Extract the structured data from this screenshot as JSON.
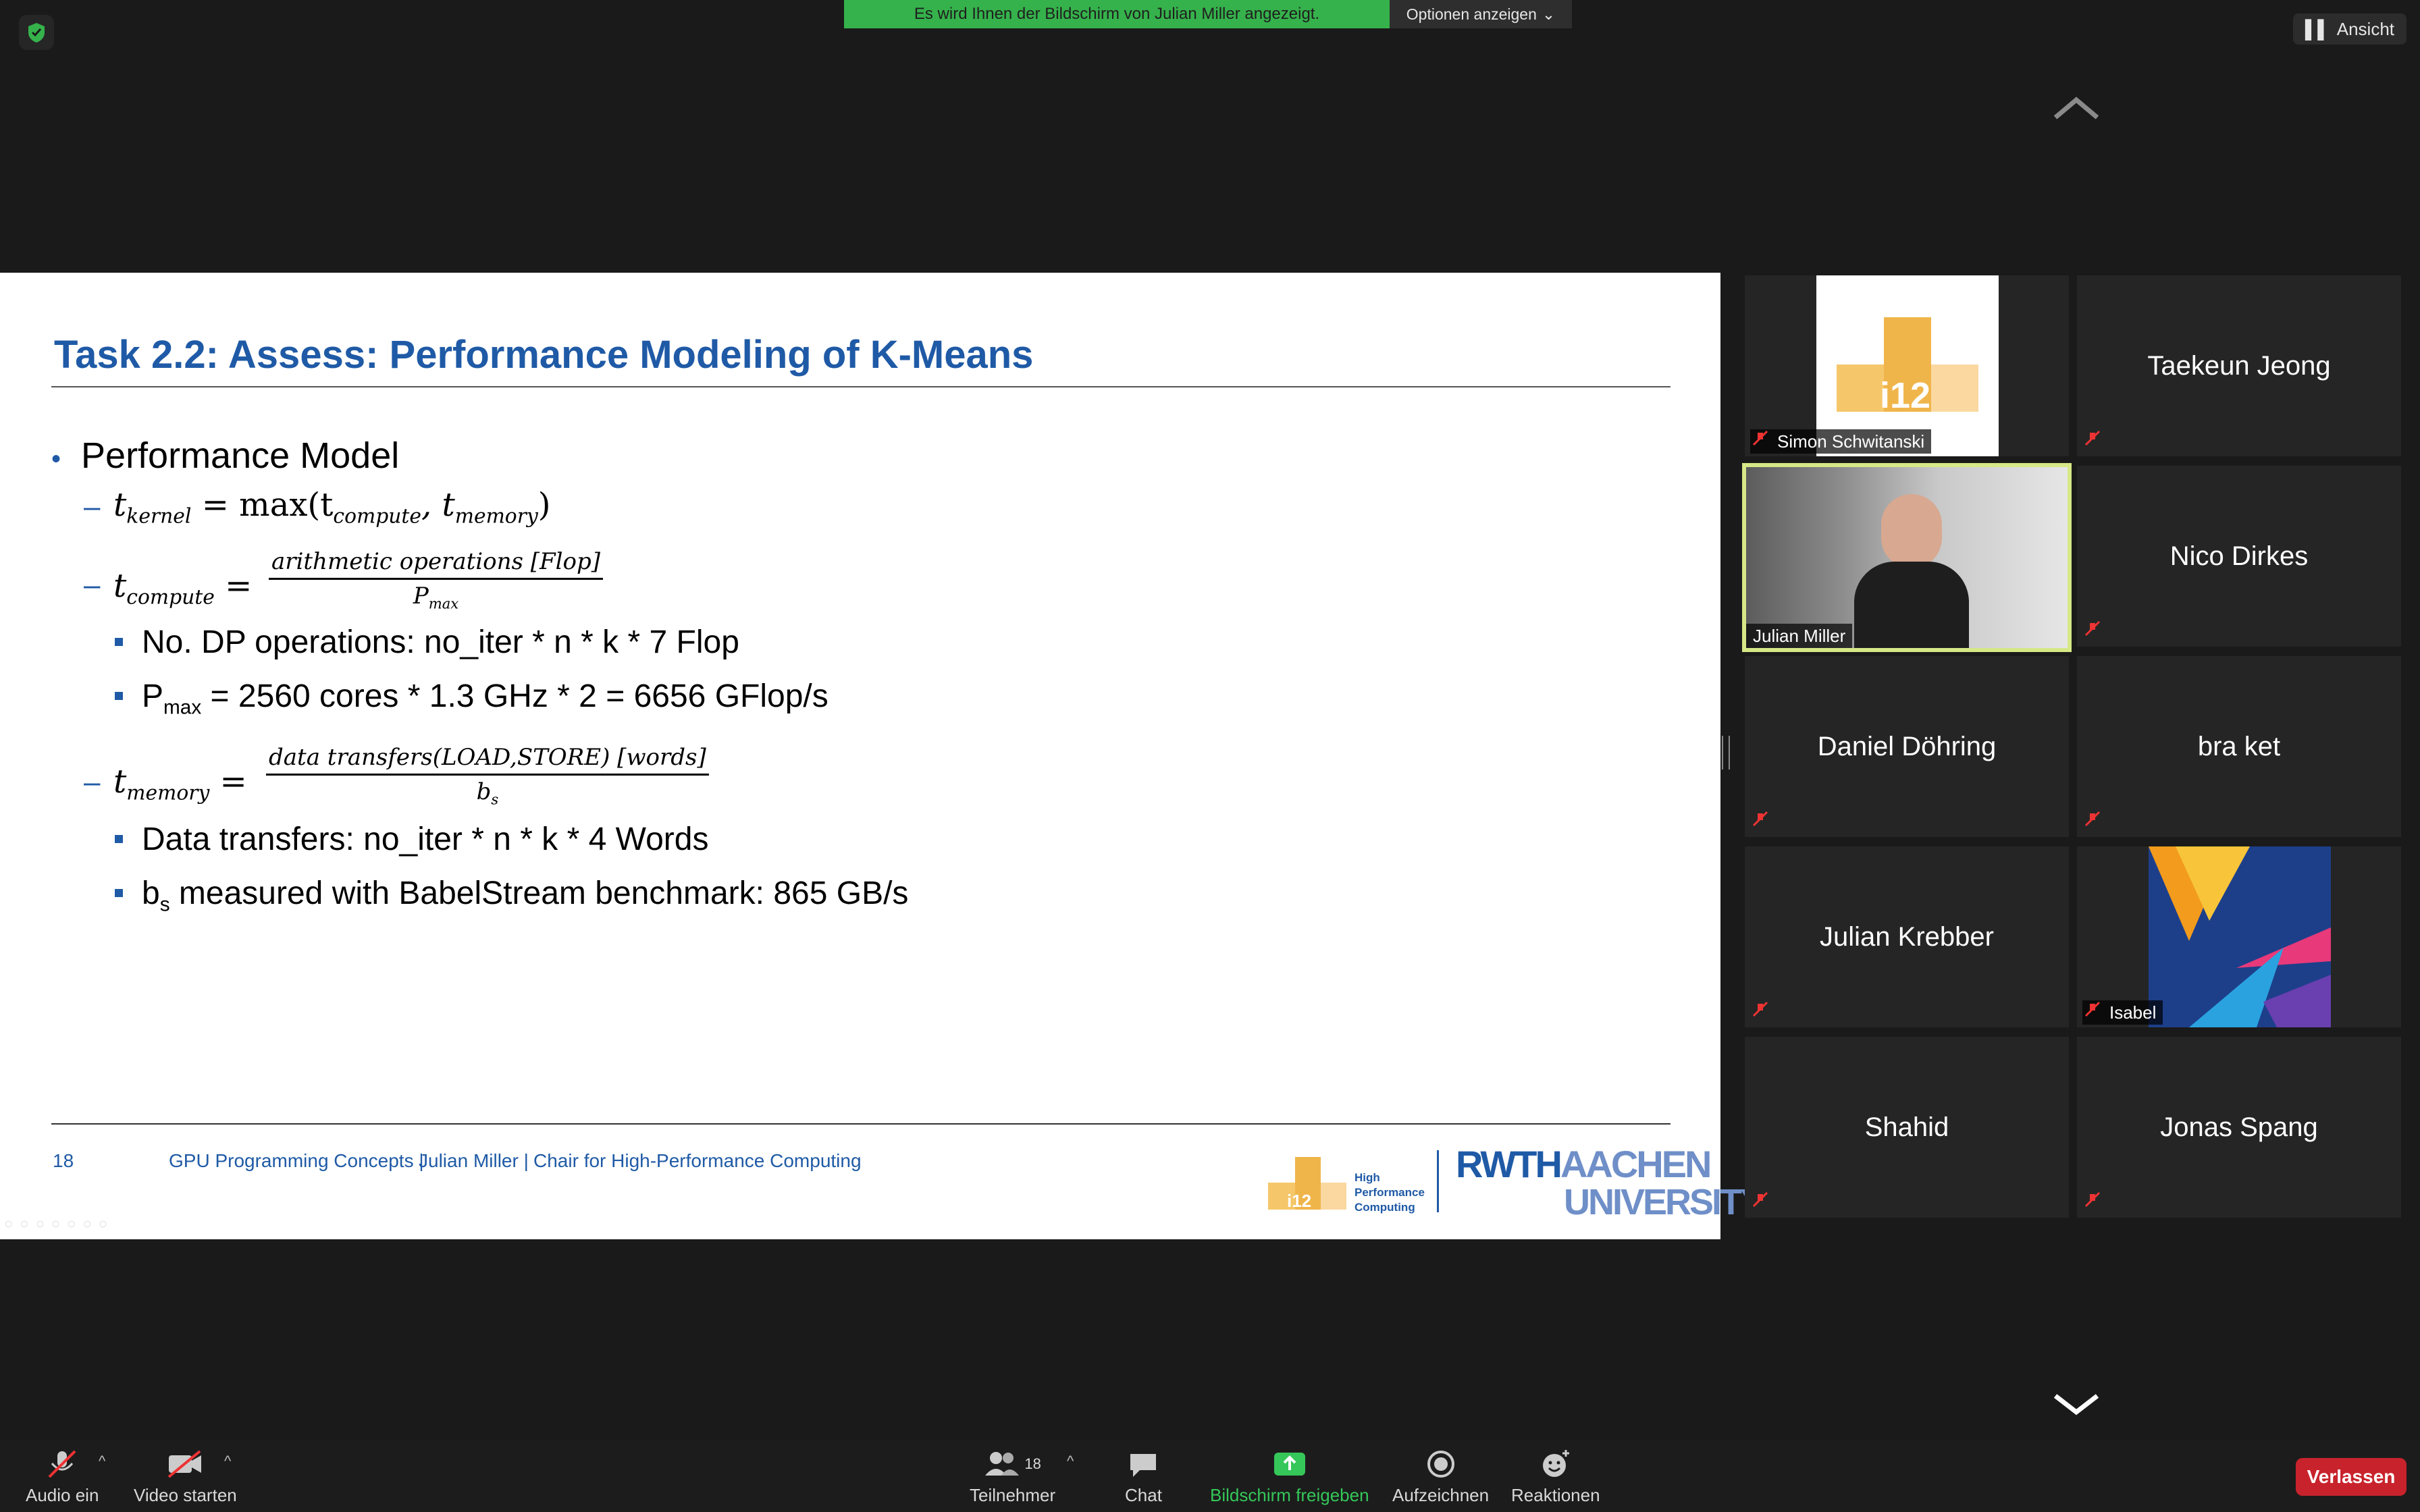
{
  "topbar": {
    "banner_text": "Es wird Ihnen der Bildschirm von Julian Miller angezeigt.",
    "options_label": "Optionen anzeigen",
    "view_label": "Ansicht",
    "security_icon": "shield-check-icon"
  },
  "slide": {
    "title": "Task 2.2: Assess: Performance Modeling of K-Means",
    "bullet_main": "Performance Model",
    "eq_kernel": {
      "lhs": "t",
      "lhs_sub": "kernel",
      "rhs": "= max(t",
      "sub1": "compute",
      "mid": ", t",
      "sub2": "memory",
      "end": ")"
    },
    "eq_compute": {
      "lhs": "t",
      "lhs_sub": "compute",
      "num": "arithmetic operations [Flop]",
      "den": "P",
      "den_sub": "max"
    },
    "compute_items": {
      "dp_ops": "No. DP operations: no_iter * n * k * 7 Flop",
      "pmax_pre": "P",
      "pmax_sub": "max",
      "pmax_post": " = 2560 cores * 1.3 GHz * 2 = 6656 GFlop/s"
    },
    "eq_memory": {
      "lhs": "t",
      "lhs_sub": "memory",
      "num": "data transfers(LOAD,STORE) [words]",
      "den": "b",
      "den_sub": "s"
    },
    "memory_items": {
      "transfers": "Data transfers: no_iter * n * k * 4 Words",
      "bs_pre": "b",
      "bs_sub": "s",
      "bs_post": " measured with BabelStream benchmark: 865 GB/s"
    },
    "footer": {
      "page": "18",
      "course": "GPU Programming Concepts |",
      "author": "Julian Miller |",
      "chair": "Chair for High-Performance Computing",
      "logo_line1": "High",
      "logo_line2": "Performance",
      "logo_line3": "Computing",
      "logo_i12": "i12",
      "rwth": "RWTH",
      "aachen": "AACHEN",
      "university": "UNIVERSITY"
    }
  },
  "participants": [
    {
      "name": "Simon Schwitanski",
      "type": "image-label",
      "muted": true
    },
    {
      "name": "Taekeun Jeong",
      "type": "name",
      "muted": true
    },
    {
      "name": "Julian Miller",
      "type": "video-label",
      "muted": false,
      "speaking": true
    },
    {
      "name": "Nico Dirkes",
      "type": "name",
      "muted": true
    },
    {
      "name": "Daniel Döhring",
      "type": "name",
      "muted": true
    },
    {
      "name": "bra ket",
      "type": "name",
      "muted": true
    },
    {
      "name": "Julian Krebber",
      "type": "name",
      "muted": true
    },
    {
      "name": "Isabel",
      "type": "image-label",
      "muted": true
    },
    {
      "name": "Shahid",
      "type": "name",
      "muted": true
    },
    {
      "name": "Jonas Spang",
      "type": "name",
      "muted": true
    }
  ],
  "toolbar": {
    "audio": "Audio ein",
    "video": "Video starten",
    "participants": "Teilnehmer",
    "participants_count": "18",
    "chat": "Chat",
    "share": "Bildschirm freigeben",
    "record": "Aufzeichnen",
    "reactions": "Reaktionen",
    "leave": "Verlassen",
    "share_color": "#35c759",
    "leave_color": "#c8232c"
  }
}
